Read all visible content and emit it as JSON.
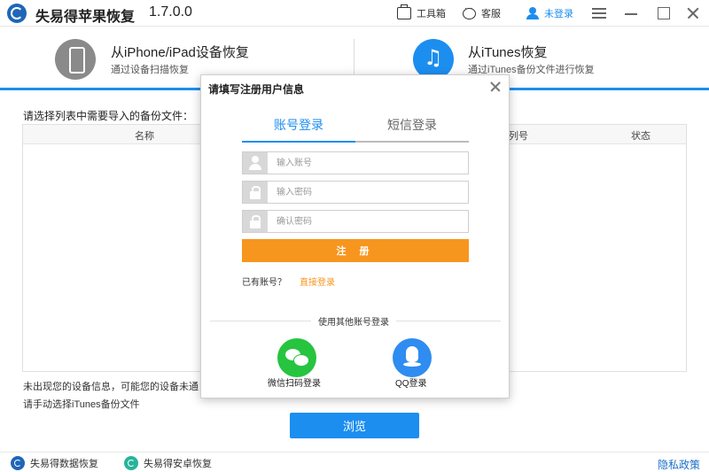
{
  "app": {
    "title": "失易得苹果恢复",
    "version": "1.7.0.0"
  },
  "titlebar": {
    "toolbox_label": "工具箱",
    "service_label": "客服",
    "login_label": "未登录"
  },
  "modes": {
    "device": {
      "title": "从iPhone/iPad设备恢复",
      "subtitle": "通过设备扫描恢复"
    },
    "itunes": {
      "title": "从iTunes恢复",
      "subtitle": "通过iTunes备份文件进行恢复"
    }
  },
  "list": {
    "label": "请选择列表中需要导入的备份文件：",
    "columns": [
      "名称",
      "列号",
      "状态"
    ]
  },
  "hints": {
    "line1": "未出现您的设备信息，可能您的设备未通",
    "line2": "请手动选择iTunes备份文件"
  },
  "browse_label": "浏览",
  "footer": {
    "data_recovery": "失易得数据恢复",
    "android_recovery": "失易得安卓恢复",
    "privacy": "隐私政策"
  },
  "modal": {
    "title": "请填写注册用户信息",
    "tabs": [
      "账号登录",
      "短信登录"
    ],
    "account_placeholder": "输入账号",
    "password_placeholder": "输入密码",
    "confirm_placeholder": "确认密码",
    "register_label": "注 册",
    "have_account": "已有账号？",
    "direct_login": "直接登录",
    "other_login": "使用其他账号登录",
    "wechat_label": "微信扫码登录",
    "qq_label": "QQ登录"
  },
  "colors": {
    "accent": "#1c8ef0",
    "orange": "#f7961e",
    "wechat": "#26c43f"
  }
}
